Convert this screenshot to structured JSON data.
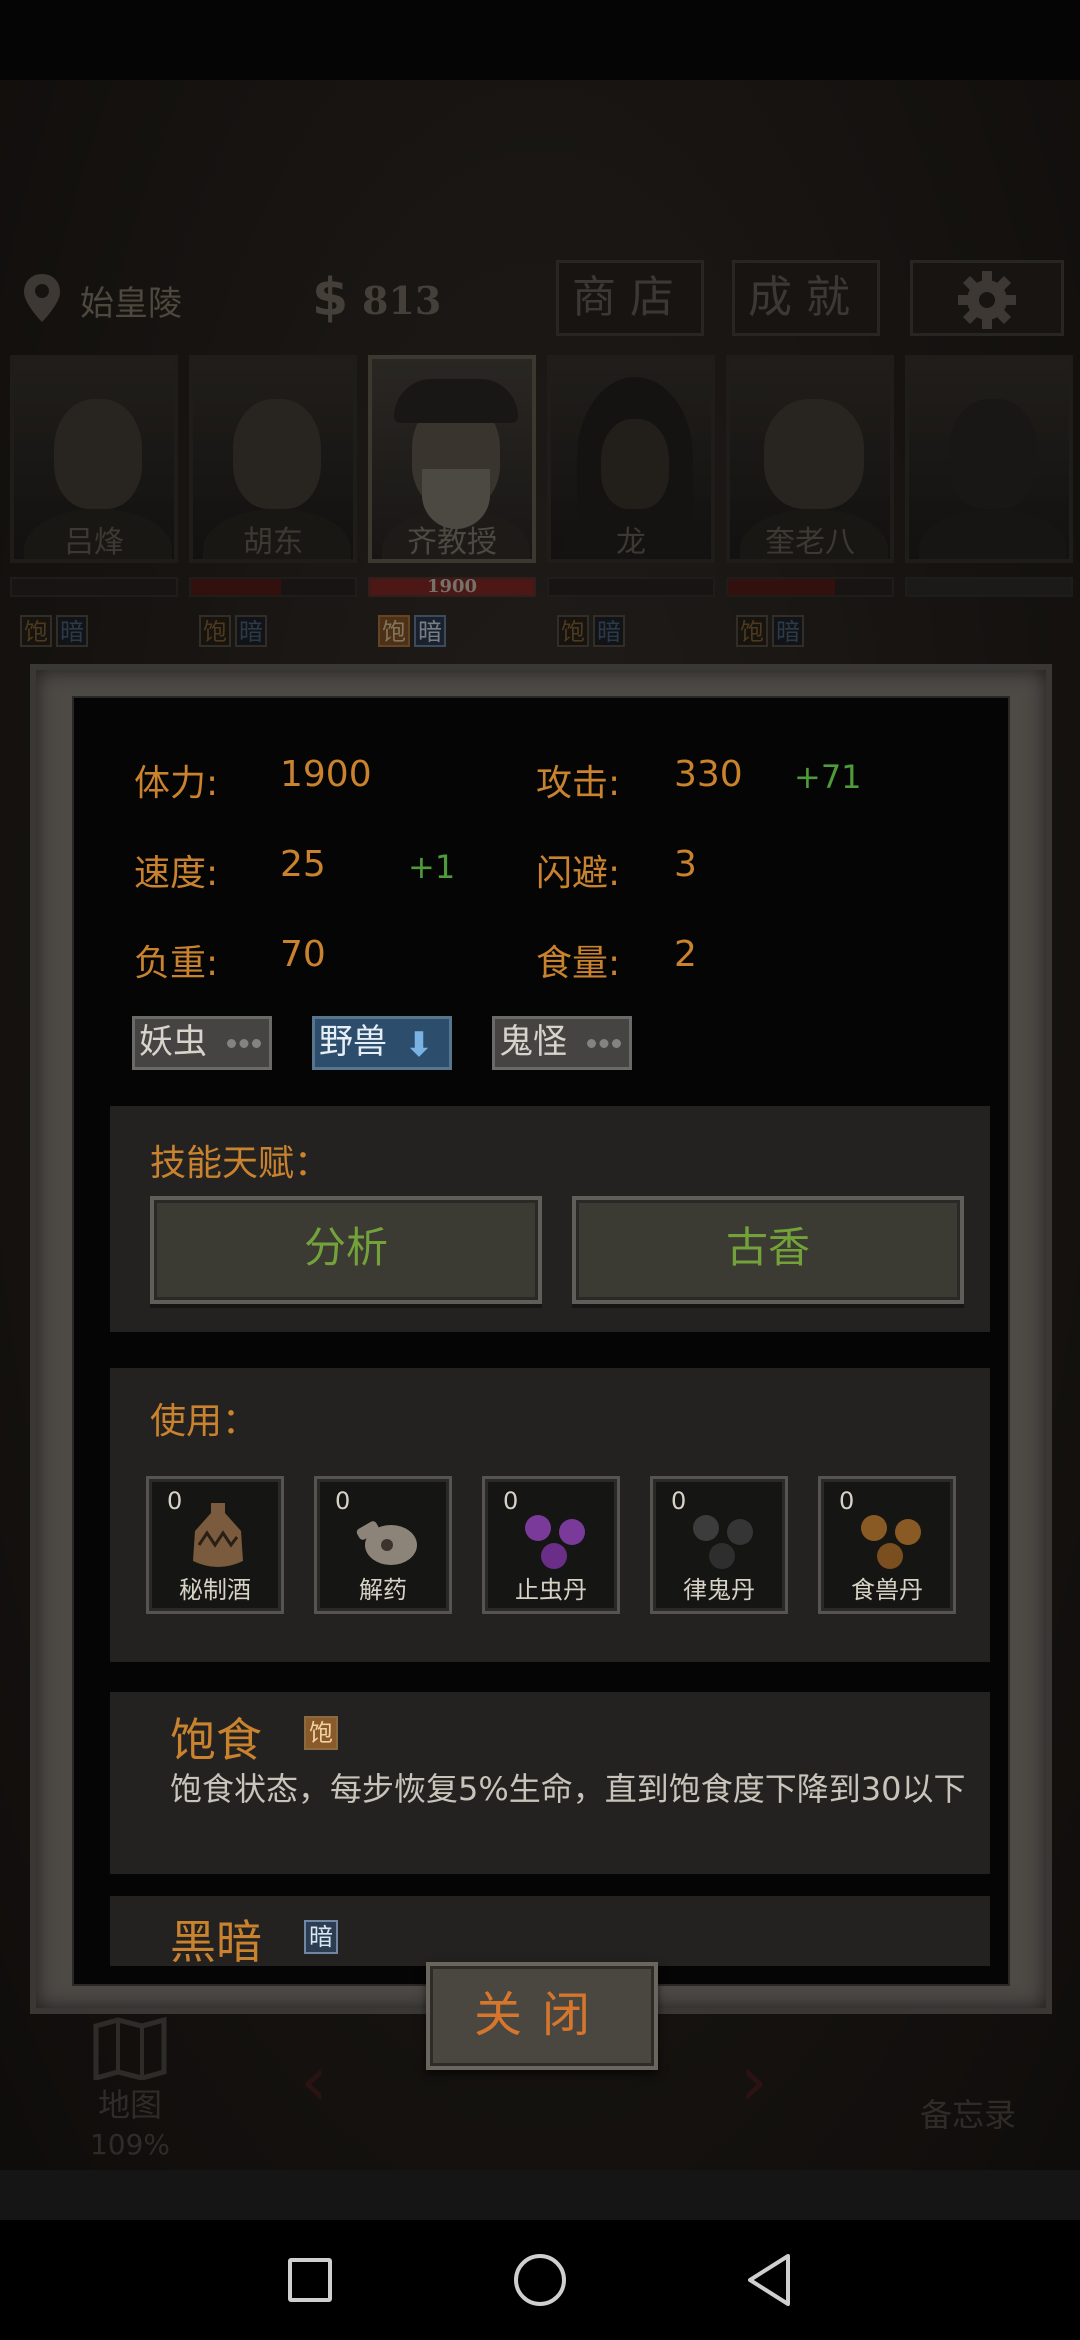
{
  "location": {
    "name": "始皇陵"
  },
  "money": {
    "symbol": "$",
    "amount": "813"
  },
  "top_buttons": {
    "shop": "商店",
    "achievements": "成就",
    "settings_icon": "gear-icon"
  },
  "characters": [
    {
      "name": "吕烽",
      "hp": "",
      "hp_fraction": 0.0,
      "selected": false,
      "tags": [
        "饱",
        "暗"
      ]
    },
    {
      "name": "胡东",
      "hp": "",
      "hp_fraction": 0.55,
      "selected": false,
      "tags": [
        "饱",
        "暗"
      ]
    },
    {
      "name": "齐教授",
      "hp": "1900",
      "hp_fraction": 1.0,
      "selected": true,
      "tags": [
        "饱",
        "暗"
      ]
    },
    {
      "name": "龙",
      "hp": "",
      "hp_fraction": 0.0,
      "selected": false,
      "tags": [
        "饱",
        "暗"
      ]
    },
    {
      "name": "奎老八",
      "hp": "",
      "hp_fraction": 0.65,
      "selected": false,
      "tags": [
        "饱",
        "暗"
      ]
    },
    {
      "name": "",
      "hp": "",
      "hp_fraction": 0.0,
      "selected": false,
      "tags": []
    }
  ],
  "stats": {
    "stamina_label": "体力:",
    "stamina": "1900",
    "attack_label": "攻击:",
    "attack": "330",
    "attack_bonus": "+71",
    "speed_label": "速度:",
    "speed": "25",
    "speed_bonus": "+1",
    "dodge_label": "闪避:",
    "dodge": "3",
    "load_label": "负重:",
    "load": "70",
    "food_label": "食量:",
    "food": "2"
  },
  "resistances": [
    {
      "label": "妖虫",
      "state": "none"
    },
    {
      "label": "野兽",
      "state": "down"
    },
    {
      "label": "鬼怪",
      "state": "none"
    }
  ],
  "skills": {
    "title": "技能天赋：",
    "items": [
      "分析",
      "古香"
    ]
  },
  "use": {
    "title": "使用：",
    "items": [
      {
        "count": "0",
        "label": "秘制酒",
        "icon": "wine-jar-icon"
      },
      {
        "count": "0",
        "label": "解药",
        "icon": "antidote-flask-icon"
      },
      {
        "count": "0",
        "label": "止虫丹",
        "icon": "purple-pills-icon",
        "color": "#7a3a9a"
      },
      {
        "count": "0",
        "label": "律鬼丹",
        "icon": "gray-pills-icon",
        "color": "#3c3c3c"
      },
      {
        "count": "0",
        "label": "食兽丹",
        "icon": "brown-pills-icon",
        "color": "#8a5a24"
      }
    ]
  },
  "status_effects": [
    {
      "title": "饱食",
      "tag": "饱",
      "desc": "饱食状态，每步恢复5%生命，直到饱食度下降到30以下"
    },
    {
      "title": "黑暗",
      "tag": "暗",
      "desc": ""
    }
  ],
  "bottom_nav": {
    "map": "地图",
    "map_pct": "109%",
    "memo": "备忘录"
  },
  "close_button": "关闭",
  "colors": {
    "stat_text": "#c9822e",
    "bonus_green": "#4f9a3a",
    "skill_green": "#74a23a",
    "close_orange": "#d6762d"
  }
}
